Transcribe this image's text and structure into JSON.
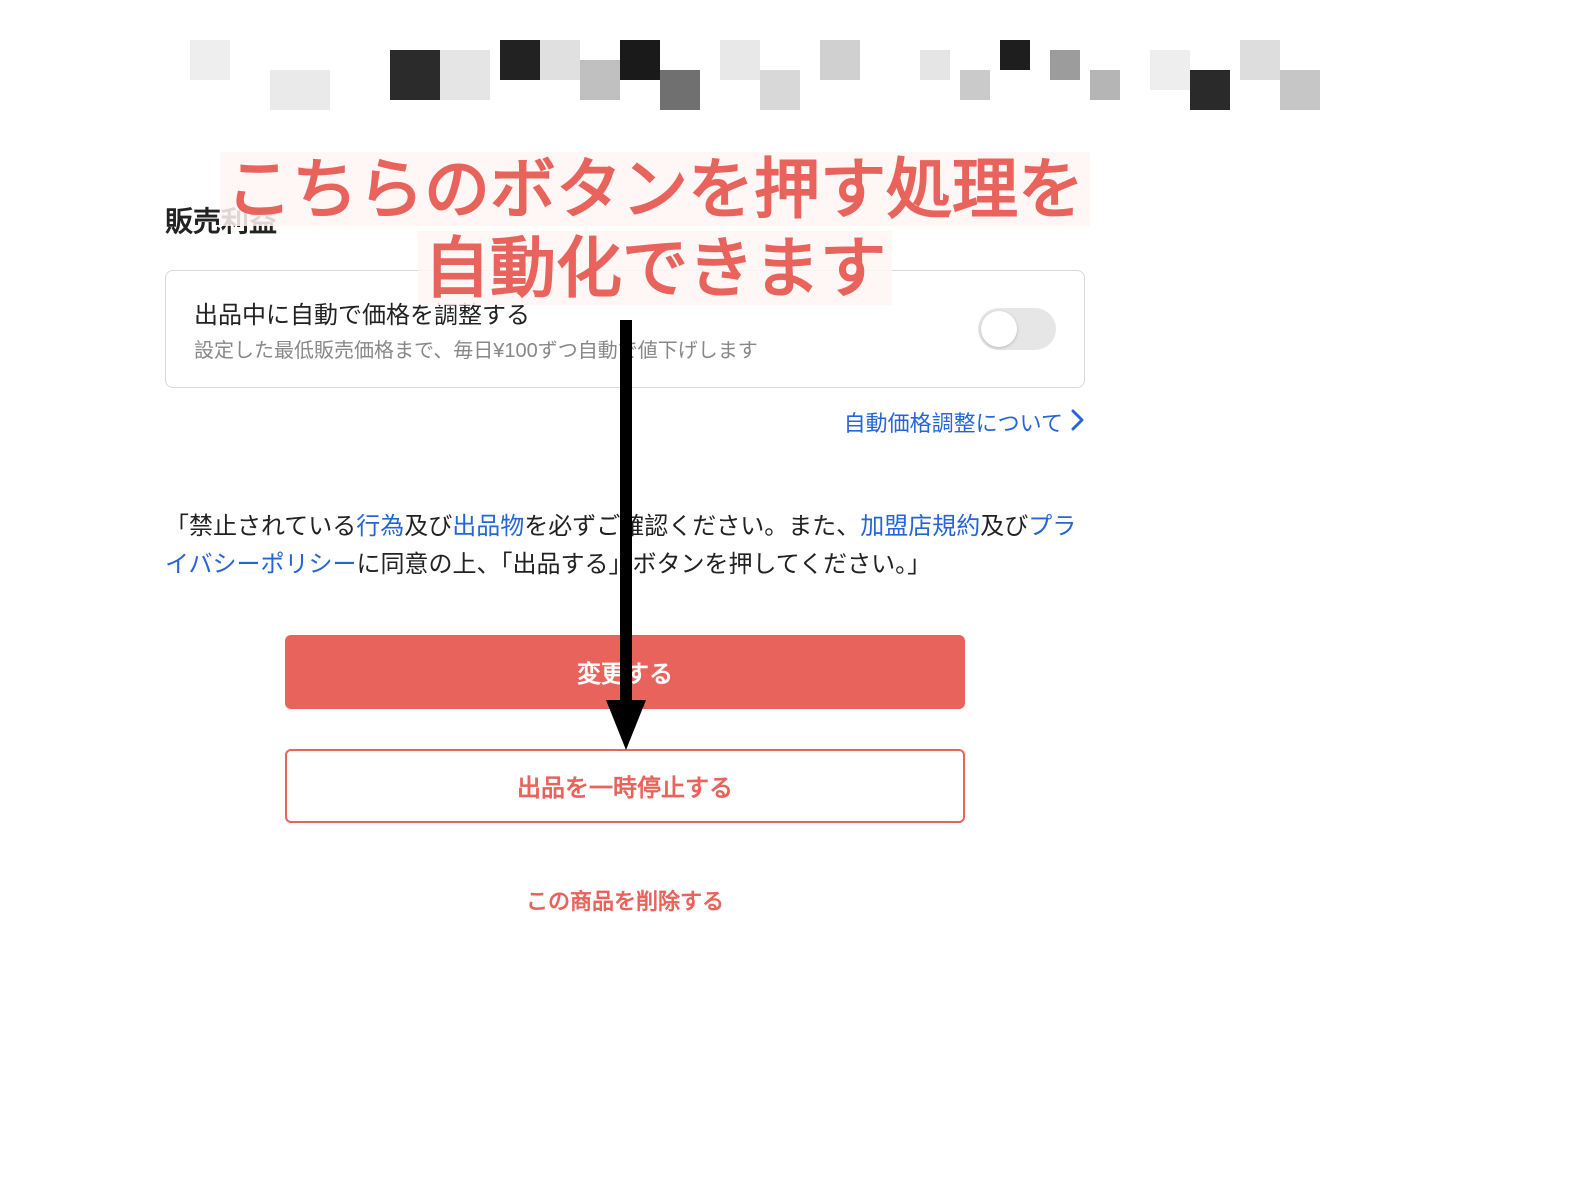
{
  "annotation": {
    "line1": "こちらのボタンを押す処理を",
    "line2": "自動化できます"
  },
  "section": {
    "sales_profit_label": "販売利益"
  },
  "auto_price_card": {
    "title": "出品中に自動で価格を調整する",
    "subtitle": "設定した最低販売価格まで、毎日¥100ずつ自動で値下げします",
    "toggle_on": false
  },
  "auto_price_link": {
    "label": "自動価格調整について"
  },
  "terms": {
    "t1": "「禁止されている",
    "link_koui": "行為",
    "t2": "及び",
    "link_shuppin": "出品物",
    "t3": "を必ずご確認ください。また、",
    "link_kameiten": "加盟店規約",
    "t4": "及び",
    "link_privacy": "プライバシーポリシー",
    "t5": "に同意の上、「出品する」ボタンを押してください。」"
  },
  "buttons": {
    "change": "変更する",
    "pause": "出品を一時停止する",
    "delete": "この商品を削除する"
  }
}
